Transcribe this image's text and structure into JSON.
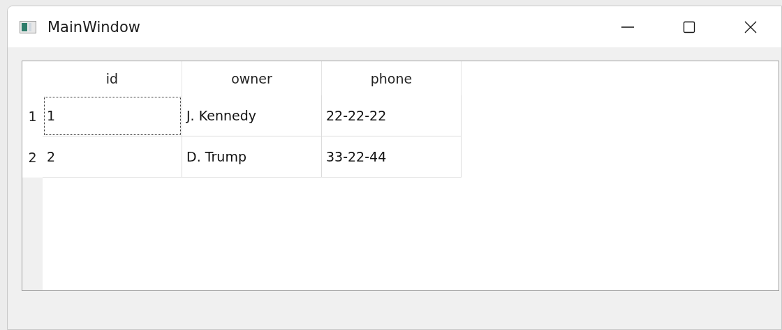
{
  "window": {
    "title": "MainWindow"
  },
  "table": {
    "columns": [
      "id",
      "owner",
      "phone"
    ],
    "rows": [
      {
        "header": "1",
        "cells": [
          {
            "text": "1",
            "focused": true
          },
          {
            "text": "J. Kennedy",
            "focused": false
          },
          {
            "text": "22-22-22",
            "focused": false
          }
        ]
      },
      {
        "header": "2",
        "cells": [
          {
            "text": "2",
            "focused": false
          },
          {
            "text": "D. Trump",
            "focused": false
          },
          {
            "text": "33-22-44",
            "focused": false
          }
        ]
      }
    ]
  }
}
